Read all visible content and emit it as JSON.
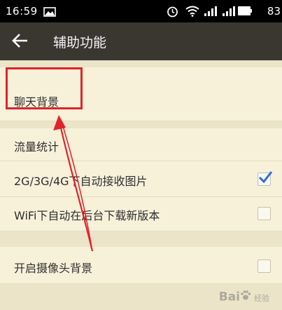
{
  "status_bar": {
    "time": "16:59",
    "battery": "83",
    "icons": [
      "image-icon",
      "alarm-icon",
      "wifi-icon",
      "signal-icon",
      "signal-icon",
      "battery-icon"
    ]
  },
  "app_bar": {
    "title": "辅助功能",
    "back_icon": "back-arrow-icon"
  },
  "settings": {
    "chat_background": "聊天背景",
    "traffic_stats": "流量统计",
    "auto_receive_images": {
      "label": "2G/3G/4G下自动接收图片",
      "checked": true
    },
    "wifi_download": {
      "label": "WiFi下自动在后台下载新版本",
      "checked": false
    },
    "camera_background": {
      "label": "开启摄像头背景",
      "checked": false
    }
  },
  "watermark": {
    "brand": "Bai",
    "sub": "经验",
    "icon": "paw-icon"
  },
  "colors": {
    "app_bar": "#3a3731",
    "background": "#f5efd9",
    "highlight": "#e0222a",
    "checkmark": "#2f6fcf"
  }
}
